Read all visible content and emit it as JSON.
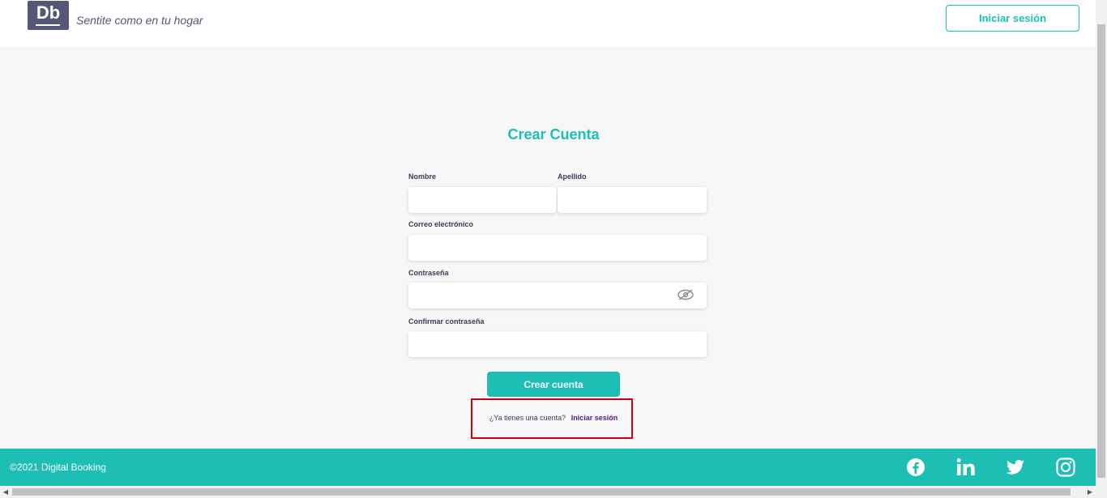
{
  "header": {
    "logo_text": "Db",
    "slogan": "Sentite como en tu hogar",
    "login_button": "Iniciar sesión"
  },
  "form": {
    "title": "Crear Cuenta",
    "first_name_label": "Nombre",
    "last_name_label": "Apellido",
    "email_label": "Correo electrónico",
    "password_label": "Contraseña",
    "confirm_password_label": "Confirmar contraseña",
    "first_name_value": "",
    "last_name_value": "",
    "email_value": "",
    "password_value": "",
    "confirm_password_value": "",
    "submit_button": "Crear cuenta",
    "has_account_text": "¿Ya tienes una cuenta?",
    "login_link": "Iniciar sesión"
  },
  "footer": {
    "copyright": "©2021 Digital Booking",
    "social_icons": [
      "facebook-icon",
      "linkedin-icon",
      "twitter-icon",
      "instagram-icon"
    ]
  },
  "colors": {
    "brand_primary": "#1dbeb4",
    "brand_dark": "#545776",
    "highlight": "#c8000b"
  }
}
